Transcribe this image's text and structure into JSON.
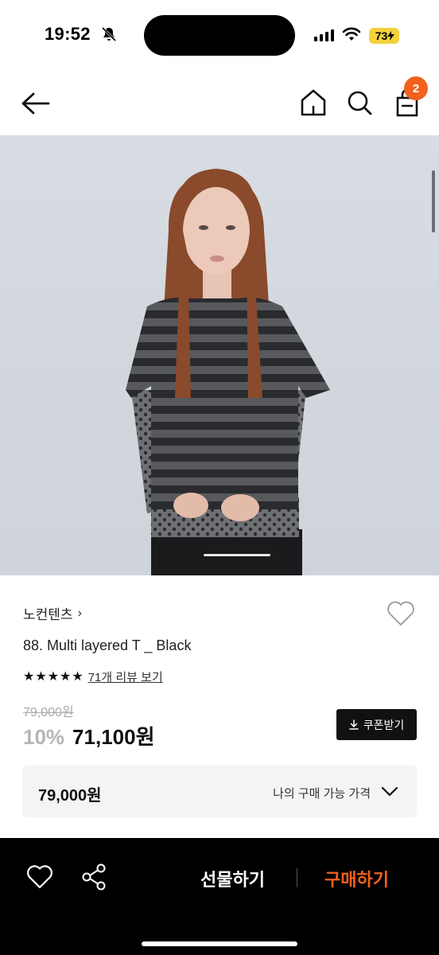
{
  "status_bar": {
    "time": "19:52",
    "battery": "73"
  },
  "header": {
    "cart_count": "2",
    "icons": [
      "back-arrow-icon",
      "home-icon",
      "search-icon",
      "shopping-bag-icon"
    ]
  },
  "product": {
    "brand": "노컨텐츠",
    "brand_chevron": "›",
    "name": "88. Multi layered T _ Black",
    "rating_stars": 5,
    "review_link": "71개 리뷰 보기",
    "original_price": "79,000원",
    "discount": "10%",
    "sale_price": "71,100원",
    "coupon_label": "쿠폰받기",
    "my_price_value": "79,000원",
    "my_price_label": "나의 구매 가능 가격"
  },
  "bottom_bar": {
    "gift_label": "선물하기",
    "buy_label": "구매하기"
  },
  "colors": {
    "accent": "#f2611d",
    "bottom_bar_bg": "#000000",
    "battery": "#f3d23b",
    "price_box_bg": "#f4f4f4"
  }
}
